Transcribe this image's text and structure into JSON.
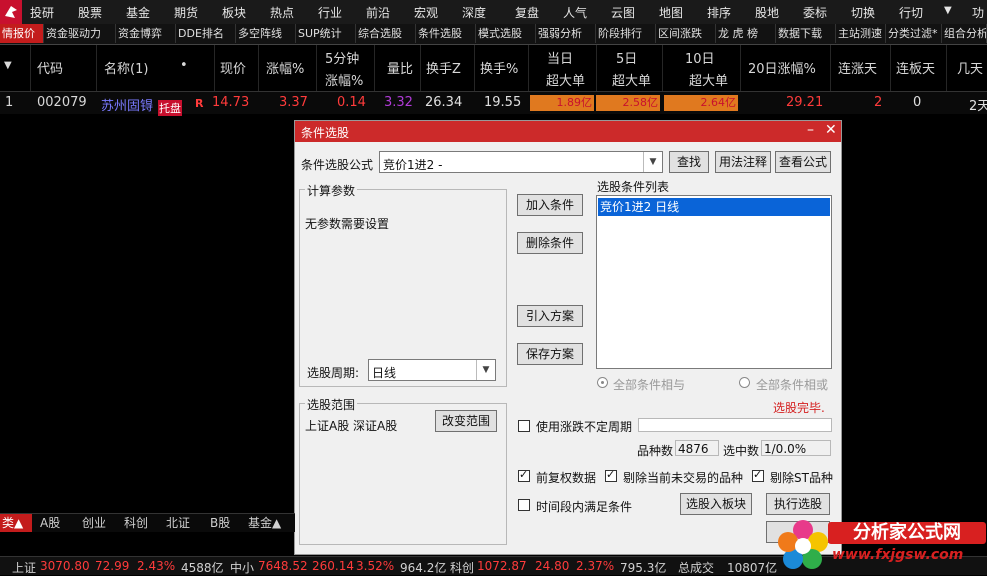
{
  "menu": [
    "投研",
    "股票",
    "基金",
    "期货",
    "板块",
    "热点",
    "行业",
    "前沿",
    "宏观",
    "深度",
    "复盘",
    "人气",
    "云图",
    "地图",
    "排序",
    "股地",
    "委标",
    "切换",
    "行切"
  ],
  "menu_right": "功",
  "tabs": [
    "情报价",
    "资金驱动力",
    "资金博弈",
    "DDE排名",
    "多空阵线",
    "SUP统计",
    "综合选股",
    "条件选股",
    "模式选股",
    "强弱分析",
    "阶段排行",
    "区间涨跌",
    "龙 虎 榜",
    "数据下载",
    "主站测速",
    "分类过滤*",
    "组合分析"
  ],
  "columns": {
    "code": "代码",
    "name": "名称(1)",
    "dot": "•",
    "price": "现价",
    "change_pct": "涨幅%",
    "min5_top": "5分钟",
    "min5_bottom": "涨幅%",
    "vol_ratio": "量比",
    "turnover_z": "换手Z",
    "turnover": "换手%",
    "d1_top": "当日",
    "d1_bottom": "超大单",
    "d5_top": "5日",
    "d5_bottom": "超大单",
    "d10_top": "10日",
    "d10_bottom": "超大单",
    "d20_change": "20日涨幅%",
    "limit_days": "连涨天",
    "board_days": "连板天",
    "days": "几天"
  },
  "row": {
    "index": "1",
    "code": "002079",
    "name": "苏州固锝",
    "badge": "托盘",
    "flag": "R",
    "price": "14.73",
    "change_pct": "3.37",
    "min5": "0.14",
    "vol_ratio": "3.32",
    "turnover_z": "26.34",
    "turnover": "19.55",
    "d1": "1.89亿",
    "d5": "2.58亿",
    "d10": "2.64亿",
    "d20_change": "29.21",
    "limit_days": "2",
    "board_days": "0",
    "days": "2天"
  },
  "dialog": {
    "title": "条件选股",
    "formula_label": "条件选股公式",
    "formula_value": "竞价1进2     -",
    "btn_find": "查找",
    "btn_usage": "用法注释",
    "btn_view": "查看公式",
    "params_group": "计算参数",
    "params_text": "无参数需要设置",
    "period_label": "选股周期:",
    "period_value": "日线",
    "btn_add": "加入条件",
    "btn_delete": "删除条件",
    "btn_import": "引入方案",
    "btn_save": "保存方案",
    "list_label": "选股条件列表",
    "list_items": [
      "竞价1进2  日线"
    ],
    "radio_and": "全部条件相与",
    "radio_or": "全部条件相或",
    "status": "选股完毕.",
    "scope_group": "选股范围",
    "scope_text": "上证A股 深证A股",
    "btn_change": "改变范围",
    "chk_variable": "使用涨跌不定周期",
    "count_label": "品种数",
    "count_value": "4876",
    "selected_label": "选中数",
    "selected_value": "1/0.0%",
    "chk_adjust": "前复权数据",
    "chk_exclude_untraded": "剔除当前未交易的品种",
    "chk_exclude_st": "剔除ST品种",
    "chk_timerange": "时间段内满足条件",
    "btn_to_block": "选股入板块",
    "btn_execute": "执行选股"
  },
  "bottom_tabs": [
    "类▲",
    "A股",
    "创业",
    "科创",
    "北证",
    "B股",
    "基金▲"
  ],
  "status_bar": {
    "sh_label": "上证",
    "sh_index": "3070.80",
    "sh_change": "72.99",
    "sh_pct": "2.43%",
    "sh_amount": "4588亿",
    "zx_label": "中小",
    "zx_index": "7648.52",
    "zx_change": "260.14",
    "zx_pct": "3.52%",
    "zx_amount": "964.2亿",
    "kc_label": "科创",
    "kc_index": "1072.87",
    "kc_change": "24.80",
    "kc_pct": "2.37%",
    "kc_amount": "795.3亿",
    "total_label": "总成交",
    "total_value": "10807亿"
  },
  "watermark": {
    "title": "分析家公式网",
    "url": "www.fxjgsw.com"
  },
  "colors": {
    "menu_bg": "#1a1a1a",
    "active_tab": "#c31c1c",
    "dialog_title": "#cc2a2a",
    "up_red": "#ff3b3b",
    "purple": "#b13bd8",
    "bar_orange": "#e0791f",
    "selected_blue": "#0a64d8"
  }
}
